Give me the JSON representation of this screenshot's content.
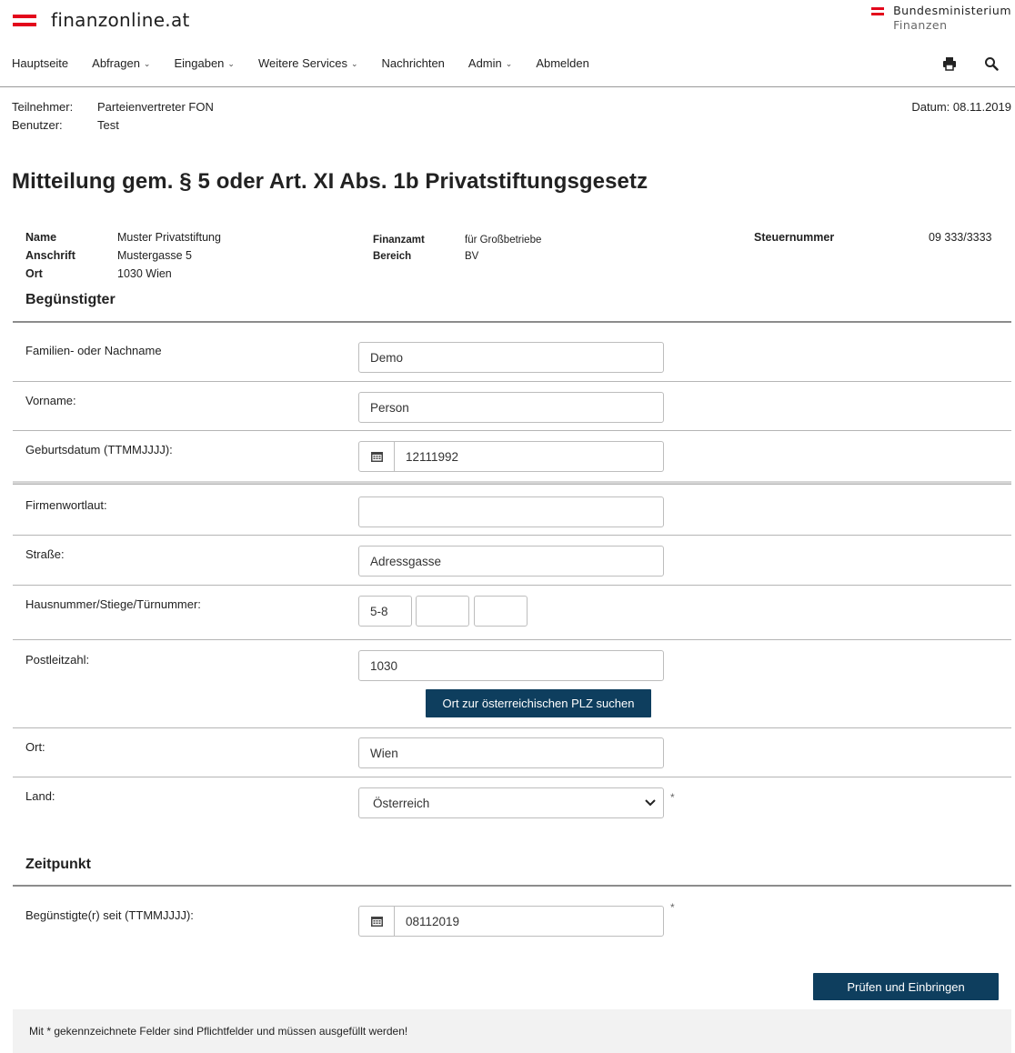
{
  "brand": {
    "name": "finanzonline.at",
    "ministry_line1": "Bundesministerium",
    "ministry_line2": "Finanzen",
    "accent_color": "#e3061b"
  },
  "nav": {
    "items": [
      {
        "label": "Hauptseite",
        "dropdown": false
      },
      {
        "label": "Abfragen",
        "dropdown": true
      },
      {
        "label": "Eingaben",
        "dropdown": true
      },
      {
        "label": "Weitere Services",
        "dropdown": true
      },
      {
        "label": "Nachrichten",
        "dropdown": false
      },
      {
        "label": "Admin",
        "dropdown": true
      },
      {
        "label": "Abmelden",
        "dropdown": false
      }
    ],
    "tools": [
      "print-icon",
      "search-icon"
    ]
  },
  "meta": {
    "teilnehmer_label": "Teilnehmer:",
    "teilnehmer_value": "Parteienvertreter FON",
    "benutzer_label": "Benutzer:",
    "benutzer_value": "Test",
    "datum": "Datum: 08.11.2019"
  },
  "page_title": "Mitteilung gem. § 5 oder Art. XI Abs. 1b Privatstiftungsgesetz",
  "info": {
    "name_label": "Name",
    "name_value": "Muster Privatstiftung",
    "anschrift_label": "Anschrift",
    "anschrift_value": "Mustergasse 5",
    "ort_label": "Ort",
    "ort_value": "1030 Wien",
    "finanzamt_label": "Finanzamt",
    "finanzamt_value": "für Großbetriebe",
    "bereich_label": "Bereich",
    "bereich_value": "BV",
    "steuernummer_label": "Steuernummer",
    "steuernummer_value": "09 333/3333"
  },
  "beguenstigter": {
    "title": "Begünstigter",
    "nachname_label": "Familien- oder Nachname",
    "nachname_value": "Demo",
    "vorname_label": "Vorname:",
    "vorname_value": "Person",
    "geburtsdatum_label": "Geburtsdatum (TTMMJJJJ):",
    "geburtsdatum_value": "12111992",
    "firmenwortlaut_label": "Firmenwortlaut:",
    "firmenwortlaut_value": "",
    "strasse_label": "Straße:",
    "strasse_value": "Adressgasse",
    "hausnummer_label": "Hausnummer/Stiege/Türnummer:",
    "hausnummer_value": "5-8",
    "stiege_value": "",
    "tuer_value": "",
    "plz_label": "Postleitzahl:",
    "plz_value": "1030",
    "plz_button": "Ort zur österreichischen PLZ suchen",
    "ort_label": "Ort:",
    "ort_value": "Wien",
    "land_label": "Land:",
    "land_value": "Österreich"
  },
  "zeitpunkt": {
    "title": "Zeitpunkt",
    "seit_label": "Begünstigte(r) seit (TTMMJJJJ):",
    "seit_value": "08112019"
  },
  "required_marker": "*",
  "submit_button": "Prüfen und Einbringen",
  "footer_note": "Mit * gekennzeichnete Felder sind Pflichtfelder und müssen ausgefüllt werden!",
  "button_color": "#0e3e5e"
}
